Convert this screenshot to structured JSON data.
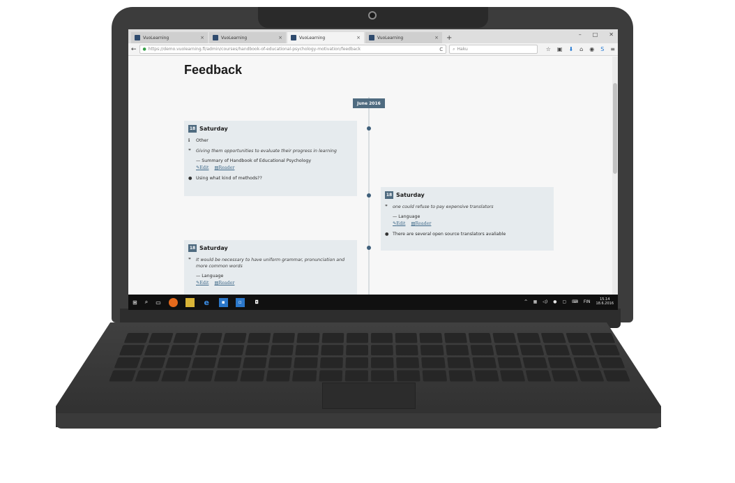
{
  "browser": {
    "tabs": [
      {
        "label": "VuoLearning",
        "close": "×",
        "active": false
      },
      {
        "label": "VuoLearning",
        "close": "×",
        "active": false
      },
      {
        "label": "VuoLearning",
        "close": "×",
        "active": true
      },
      {
        "label": "VuoLearning",
        "close": "×",
        "active": false
      }
    ],
    "new_tab": "+",
    "window_controls": {
      "minimize": "–",
      "maximize": "□",
      "close": "✕"
    },
    "back": "←",
    "url": "https://demo.vuolearning.fi/admin/courses/handbook-of-educational-psychology-motivation/feedback",
    "reload": "C",
    "search_placeholder": "Haku",
    "toolbar_icons": [
      "star-icon",
      "clipboard-icon",
      "download-icon",
      "home-icon",
      "extension-icon",
      "skype-icon",
      "menu-icon"
    ]
  },
  "page": {
    "title": "Feedback",
    "month": "June 2016",
    "cards": [
      {
        "day": "18",
        "weekday": "Saturday",
        "category": "Other",
        "quote": "Giving them opportunities to evaluate their progress in learning",
        "source": "— Summary of Handbook of Educational Psychology",
        "edit": "Edit",
        "reader": "Reader",
        "comment": "Using what kind of methods??"
      },
      {
        "day": "18",
        "weekday": "Saturday",
        "quote": "one could refuse to pay expensive translators",
        "source": "— Language",
        "edit": "Edit",
        "reader": "Reader",
        "comment": "There are several open source translators avaliable"
      },
      {
        "day": "18",
        "weekday": "Saturday",
        "quote": "It would be necessary to have uniform grammar, pronunciation and more common words",
        "source": "— Language",
        "edit": "Edit",
        "reader": "Reader"
      }
    ]
  },
  "taskbar": {
    "language": "FIN",
    "time": "15.14",
    "date": "18.6.2016"
  }
}
